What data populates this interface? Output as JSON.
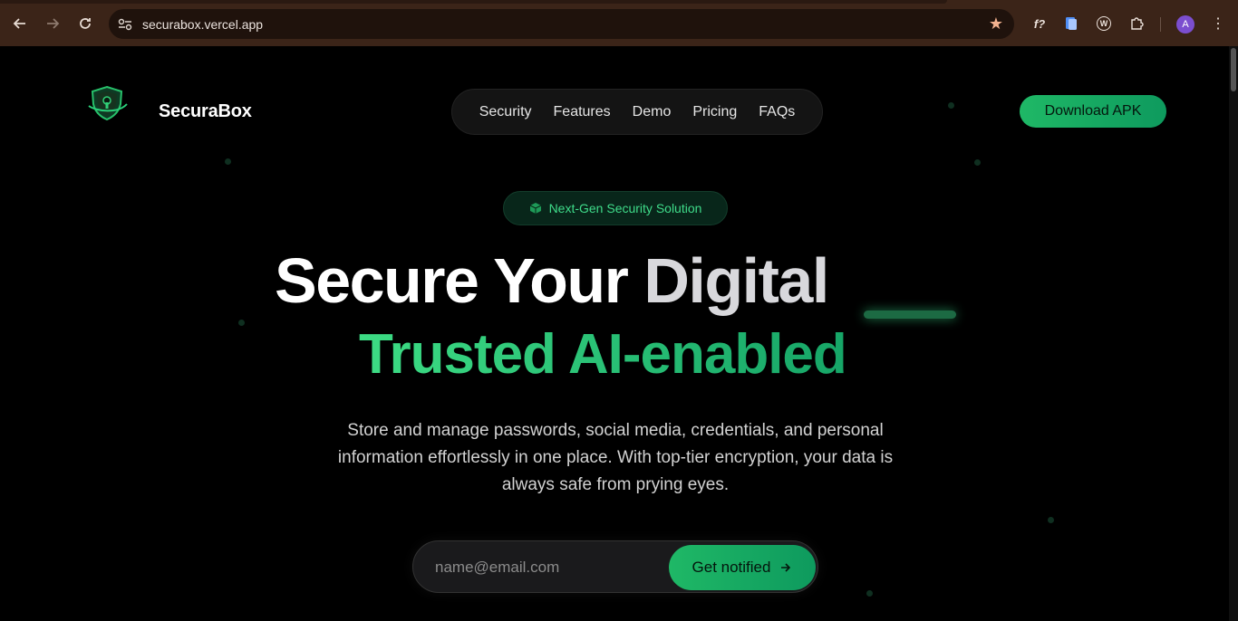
{
  "browser": {
    "url": "securabox.vercel.app",
    "avatar_letter": "A",
    "extensions": [
      "f?",
      "docs-icon",
      "W",
      "puzzle-icon"
    ]
  },
  "header": {
    "brand": "SecuraBox",
    "nav": [
      "Security",
      "Features",
      "Demo",
      "Pricing",
      "FAQs"
    ],
    "download_label": "Download APK"
  },
  "hero": {
    "badge": "Next-Gen Security Solution",
    "headline_1": "Secure Your ",
    "headline_1_fade": "Digital",
    "headline_2": "Trusted AI-enabled",
    "description": "Store and manage passwords, social media, credentials, and personal information effortlessly in one place. With top-tier encryption, your data is always safe from prying eyes.",
    "email_placeholder": "name@email.com",
    "notify_label": "Get notified"
  },
  "colors": {
    "accent": "#1fb866",
    "accent_dark": "#0e9a5e",
    "background": "#000000",
    "chrome": "#3b2418"
  }
}
